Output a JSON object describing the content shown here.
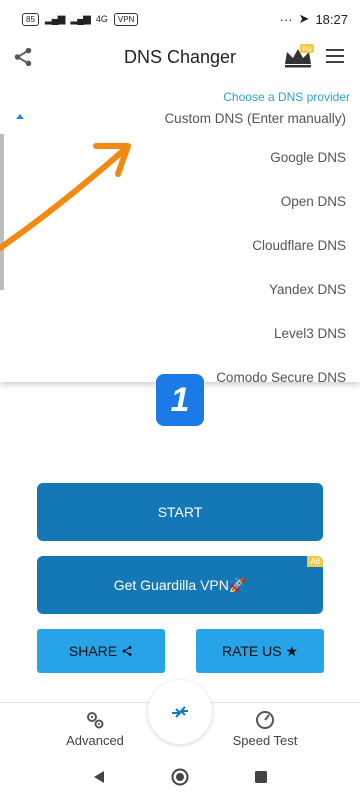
{
  "status_bar": {
    "battery": "85",
    "network": "4G",
    "vpn": "VPN",
    "dots": "···",
    "time": "18:27"
  },
  "app_bar": {
    "title": "DNS Changer",
    "pro_badge": "Pro"
  },
  "dropdown": {
    "caption": "Choose a DNS provider",
    "selected": "Custom DNS (Enter manually)",
    "options": [
      "Google DNS",
      "Open DNS",
      "Cloudflare DNS",
      "Yandex DNS",
      "Level3 DNS",
      "Comodo Secure DNS"
    ]
  },
  "annotation": {
    "step_number": "1"
  },
  "buttons": {
    "start": "START",
    "vpn": "Get Guardilla VPN🚀",
    "ad_tag": "Ad",
    "share": "SHARE",
    "rate": "RATE US ★"
  },
  "bottom_nav": {
    "advanced": "Advanced",
    "speed_test": "Speed Test"
  },
  "colors": {
    "primary_button": "#1378b5",
    "secondary_button": "#27a3e8",
    "accent": "#2aa6c4",
    "annotation_arrow": "#f28a12",
    "badge": "#1c7ae6"
  }
}
